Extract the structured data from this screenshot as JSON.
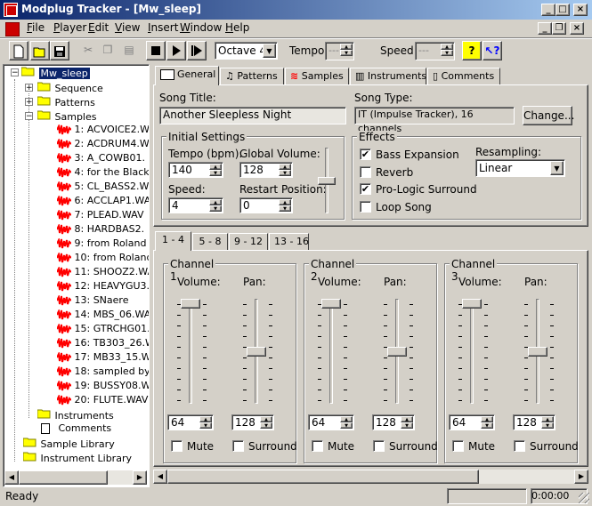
{
  "window": {
    "title": "Modplug Tracker - [Mw_sleep]",
    "controls": [
      "_",
      "□",
      "×"
    ],
    "mdi_controls": [
      "_",
      "❐",
      "×"
    ]
  },
  "menu": [
    "File",
    "Player",
    "Edit",
    "View",
    "Insert",
    "Window",
    "Help"
  ],
  "toolbar": {
    "octave": "Octave 4",
    "tempo_label": "Tempo:",
    "tempo_value": "---",
    "speed_label": "Speed:",
    "speed_value": "---"
  },
  "tree": {
    "root": "Mw_sleep",
    "nodes": {
      "sequence": "Sequence",
      "patterns": "Patterns",
      "samples": "Samples",
      "instruments": "Instruments",
      "comments": "Comments",
      "sample_library": "Sample Library",
      "instrument_library": "Instrument Library"
    },
    "samples": [
      "1: ACVOICE2.W",
      "2: ACDRUM4.W",
      "3: A_COWB01.",
      "4:  for the Black",
      "5: CL_BASS2.W",
      "6: ACCLAP1.WA",
      "7: PLEAD.WAV",
      "8: HARDBAS2.",
      "9: from Roland t",
      "10: from Roland",
      "11: SHOOZ2.WA",
      "12: HEAVYGU3.",
      "13: SNaere",
      "14: MBS_06.WA",
      "15: GTRCHG01.",
      "16: TB303_26.W",
      "17: MB33_15.W",
      "18: sampled by",
      "19: BUSSY08.W",
      "20: FLUTE.WAV"
    ]
  },
  "tabs": [
    "General",
    "Patterns",
    "Samples",
    "Instruments",
    "Comments"
  ],
  "general": {
    "song_title_label": "Song Title:",
    "song_title": "Another Sleepless Night",
    "song_type_label": "Song Type:",
    "song_type": "IT (Impulse Tracker), 16 channels",
    "change_button": "Change...",
    "initial_settings": "Initial Settings",
    "tempo_label": "Tempo (bpm):",
    "tempo": "140",
    "global_volume_label": "Global Volume:",
    "global_volume": "128",
    "speed_label": "Speed:",
    "speed": "4",
    "restart_label": "Restart Position:",
    "restart": "0",
    "effects": "Effects",
    "bass_expansion": "Bass Expansion",
    "reverb": "Reverb",
    "prologic": "Pro-Logic Surround",
    "loop_song": "Loop Song",
    "resampling_label": "Resampling:",
    "resampling": "Linear"
  },
  "channel_tabs": [
    "1 - 4",
    "5 - 8",
    "9 - 12",
    "13 - 16"
  ],
  "channels": [
    {
      "name": "Channel 1",
      "volume": "64",
      "pan": "128",
      "volume_level": 1.0,
      "pan_level": 0.5
    },
    {
      "name": "Channel 2",
      "volume": "64",
      "pan": "128",
      "volume_level": 1.0,
      "pan_level": 0.5
    },
    {
      "name": "Channel 3",
      "volume": "64",
      "pan": "128",
      "volume_level": 1.0,
      "pan_level": 0.5
    }
  ],
  "channel_labels": {
    "volume": "Volume:",
    "pan": "Pan:",
    "mute": "Mute",
    "surround": "Surround"
  },
  "status": {
    "text": "Ready",
    "time": "0:00:00"
  },
  "colors": {
    "title_start": "#0a246a",
    "title_end": "#a6caf0",
    "wave": "#ff0000",
    "folder": "#ffff00"
  }
}
